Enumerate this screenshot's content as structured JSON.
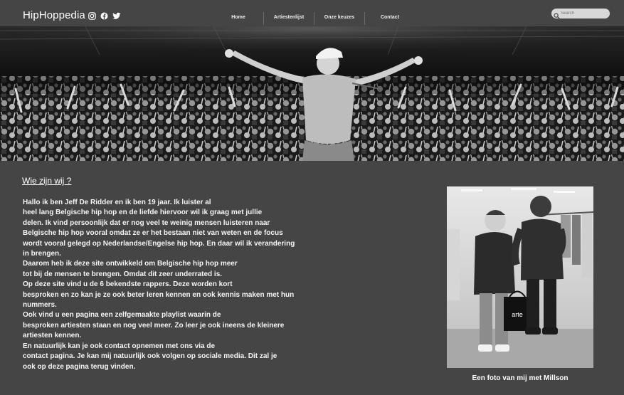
{
  "header": {
    "site_title": "HipHoppedia",
    "social_icons": [
      "instagram-icon",
      "facebook-icon",
      "twitter-icon"
    ],
    "nav": [
      {
        "label": "Home"
      },
      {
        "label": "Artiestenlijst"
      },
      {
        "label": "Onze keuzes"
      },
      {
        "label": "Contact"
      }
    ],
    "search": {
      "placeholder": "Search"
    }
  },
  "hero": {
    "description_icon": "concert-crowd-image"
  },
  "main": {
    "title": "Wie zijn wij ?",
    "lines": [
      "Hallo ik ben Jeff De Ridder en ik ben 19 jaar. Ik luister al",
      "heel lang Belgische hip hop en de liefde hiervoor wil ik graag met jullie",
      "delen. Ik vind persoonlijk dat er nog veel te weinig mensen luisteren naar",
      "Belgische hip hop vooral omdat ze er het bestaan niet van weten en de focus",
      "wordt vooral gelegd op Nederlandse/Engelse hip hop. En daar wil ik verandering",
      "in brengen.",
      "Daarom heb ik deze site ontwikkeld om Belgische hip hop meer",
      "tot bij de mensen te brengen. Omdat dit zeer underrated is.",
      "Op deze site vind u de 6 bekendste rappers. Deze worden kort",
      "besproken en zo kan je ze ook beter leren kennen en ook kennis maken met hun",
      "nummers.",
      "Ook vind u een pagina een zelfgemaakte playlist waarin de",
      "besproken artiesten staan en nog veel meer. Zo leer je ook ineens de kleinere",
      "artiesten kennen.",
      "En natuurlijk kan je ook contact opnemen met ons via de",
      "contact pagina. Je kan mij natuurlijk ook volgen op sociale media. Dit zal je",
      "ook op deze pagina terug vinden."
    ]
  },
  "photo": {
    "caption": "Een foto van mij met Millson",
    "bag_text": "arte"
  },
  "colors": {
    "background": "#454545",
    "hero_bg": "#0c0c0c",
    "text": "#ffffff",
    "search_bg": "#d8d8d8"
  }
}
